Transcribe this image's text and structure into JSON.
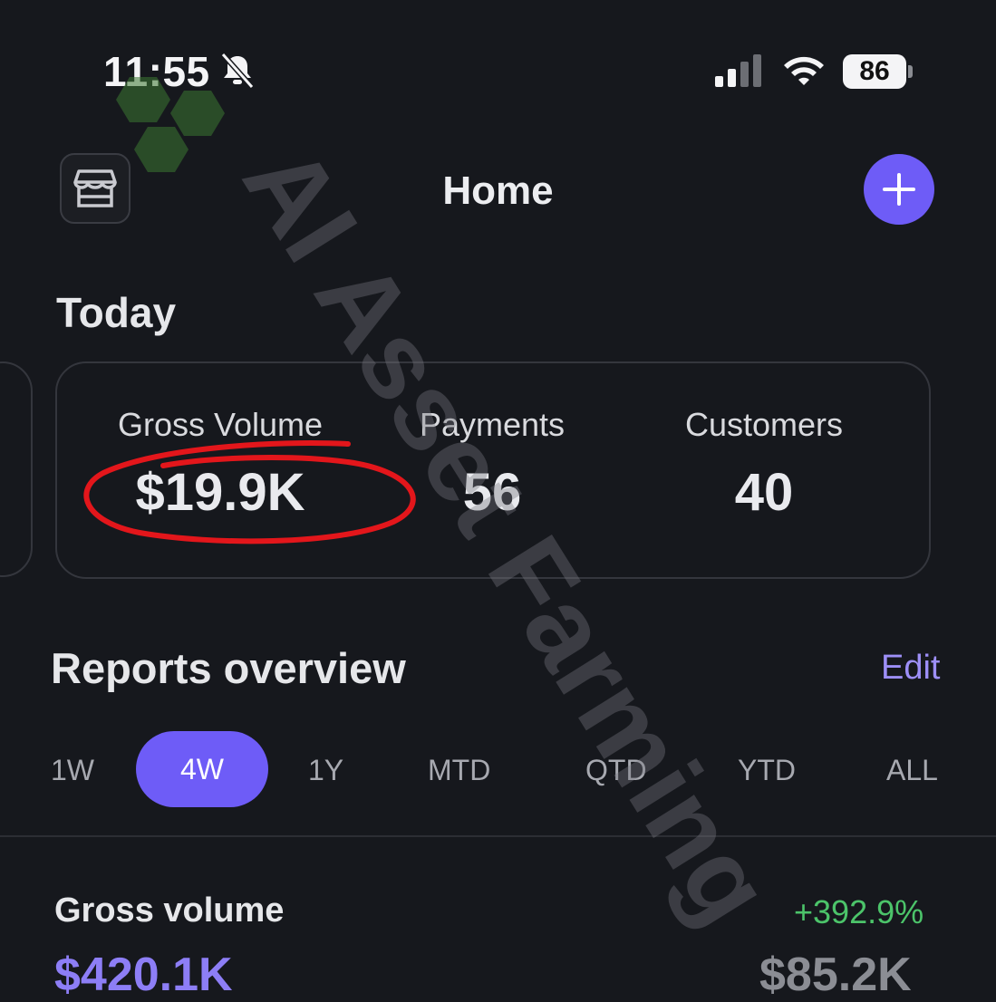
{
  "status_bar": {
    "time": "11:55",
    "battery": "86"
  },
  "header": {
    "title": "Home"
  },
  "today": {
    "title": "Today",
    "metrics": [
      {
        "label": "Gross Volume",
        "value": "$19.9K"
      },
      {
        "label": "Payments",
        "value": "56"
      },
      {
        "label": "Customers",
        "value": "40"
      }
    ]
  },
  "reports": {
    "title": "Reports overview",
    "edit_label": "Edit",
    "tabs": [
      "1W",
      "4W",
      "1Y",
      "MTD",
      "QTD",
      "YTD",
      "ALL"
    ],
    "active_tab": "4W",
    "gross_volume": {
      "title": "Gross volume",
      "change": "+392.9%",
      "value": "$420.1K",
      "previous": "$85.2K"
    }
  },
  "watermark": {
    "text": "AI Asset Farming"
  },
  "colors": {
    "background": "#16181d",
    "accent": "#6e5cf7",
    "positive": "#4cc46a",
    "annotation": "#e3161b"
  },
  "icons": {
    "store": "store-icon",
    "add": "plus-icon",
    "bell": "bell-slash-icon",
    "signal": "cellular-signal-icon",
    "wifi": "wifi-icon"
  }
}
